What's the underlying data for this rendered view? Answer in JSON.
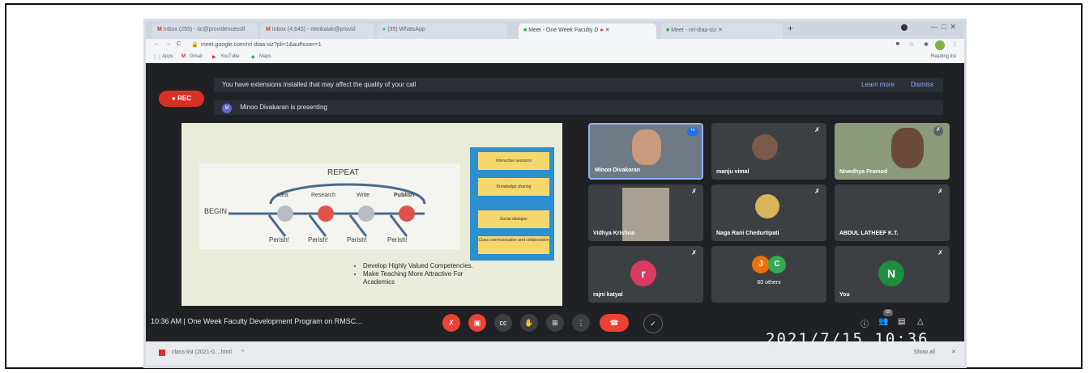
{
  "tabs": [
    {
      "label": "Inbox (255) - tic@providencecoll"
    },
    {
      "label": "Inbox (4,645) - minikalak@provid"
    },
    {
      "label": "(35) WhatsApp"
    },
    {
      "label": "Meet - One Week Faculty D"
    },
    {
      "label": "Meet - nri-diaa-siz"
    }
  ],
  "address": {
    "url": "meet.google.com/nri-diaa-siz?pli=1&authuser=1"
  },
  "bookmarks": {
    "items": [
      "Apps",
      "Gmail",
      "YouTube",
      "Maps"
    ],
    "reading_list": "Reading list"
  },
  "meet": {
    "rec_label": "REC",
    "banner_text": "You have extensions installed that may affect the quality of your call",
    "learn_more": "Learn more",
    "dismiss": "Dismiss",
    "presenting_initial": "M",
    "presenting_text": "Minoo Divakaran is presenting",
    "meeting_time": "10:36 AM",
    "meeting_title": "One Week Faculty Development Program on RMSC...",
    "participant_count": "69"
  },
  "slide": {
    "repeat": "REPEAT",
    "begin": "BEGIN",
    "steps": [
      "Idea",
      "Research",
      "Write",
      "Publish"
    ],
    "perish": [
      "Perish!",
      "Perish!",
      "Perish!",
      "Perish!"
    ],
    "bullets": [
      "Develop Highly Valued Competencies.",
      "Make Teaching More Attractive For Academics"
    ],
    "cards": [
      "Interactive sessions",
      "Knowledge sharing",
      "Social dialogue",
      "Class communication and collaboration"
    ]
  },
  "participants": [
    {
      "name": "Minoo Divakaran"
    },
    {
      "name": "manju vimal"
    },
    {
      "name": "Nivedhya Pramod"
    },
    {
      "name": "Vidhya Krishna"
    },
    {
      "name": "Naga Rani Chedurtipati"
    },
    {
      "name": "ABDUL LATHEEF K.T."
    },
    {
      "name": "rajni katyal",
      "initial": "r"
    },
    {
      "name": "60 others",
      "initials": [
        "J",
        "C"
      ]
    },
    {
      "name": "You",
      "initial": "N"
    }
  ],
  "download": {
    "file": "class-list (2021-0....html",
    "show_all": "Show all"
  },
  "photo_timestamp": "2021/7/15 10:36",
  "colors": {
    "meet_bg": "#202124",
    "tile_bg": "#3c4043",
    "rec_red": "#d93025",
    "avatar_r": "#d93b63",
    "avatar_n": "#1e8e3e",
    "avatar_j": "#e8710a",
    "avatar_c": "#34a853"
  }
}
